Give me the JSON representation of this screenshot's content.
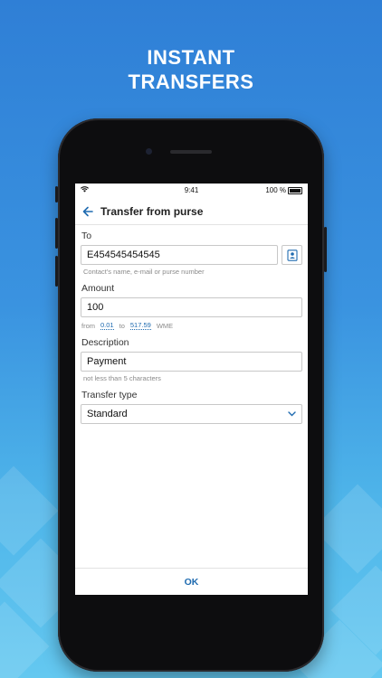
{
  "headline": {
    "line1": "INSTANT",
    "line2": "TRANSFERS"
  },
  "status_bar": {
    "time": "9:41",
    "battery": "100 %"
  },
  "nav": {
    "title": "Transfer from purse"
  },
  "form": {
    "to": {
      "label": "To",
      "value": "E454545454545",
      "hint": "Contact's name, e-mail or purse number"
    },
    "amount": {
      "label": "Amount",
      "value": "100",
      "from_label": "from",
      "min": "0.01",
      "to_label": "to",
      "max": "517.59",
      "currency": "WME"
    },
    "description": {
      "label": "Description",
      "value": "Payment",
      "hint": "not less than 5 characters"
    },
    "transfer_type": {
      "label": "Transfer type",
      "value": "Standard"
    }
  },
  "footer": {
    "ok_label": "OK"
  },
  "colors": {
    "accent": "#1f6bb0",
    "background_top": "#2f7fd6",
    "background_bottom": "#64c8f0"
  },
  "icons": {
    "back": "arrow-left-icon",
    "contacts": "contact-book-icon",
    "select": "chevron-down-icon",
    "wifi": "wifi-icon",
    "battery": "battery-icon"
  }
}
